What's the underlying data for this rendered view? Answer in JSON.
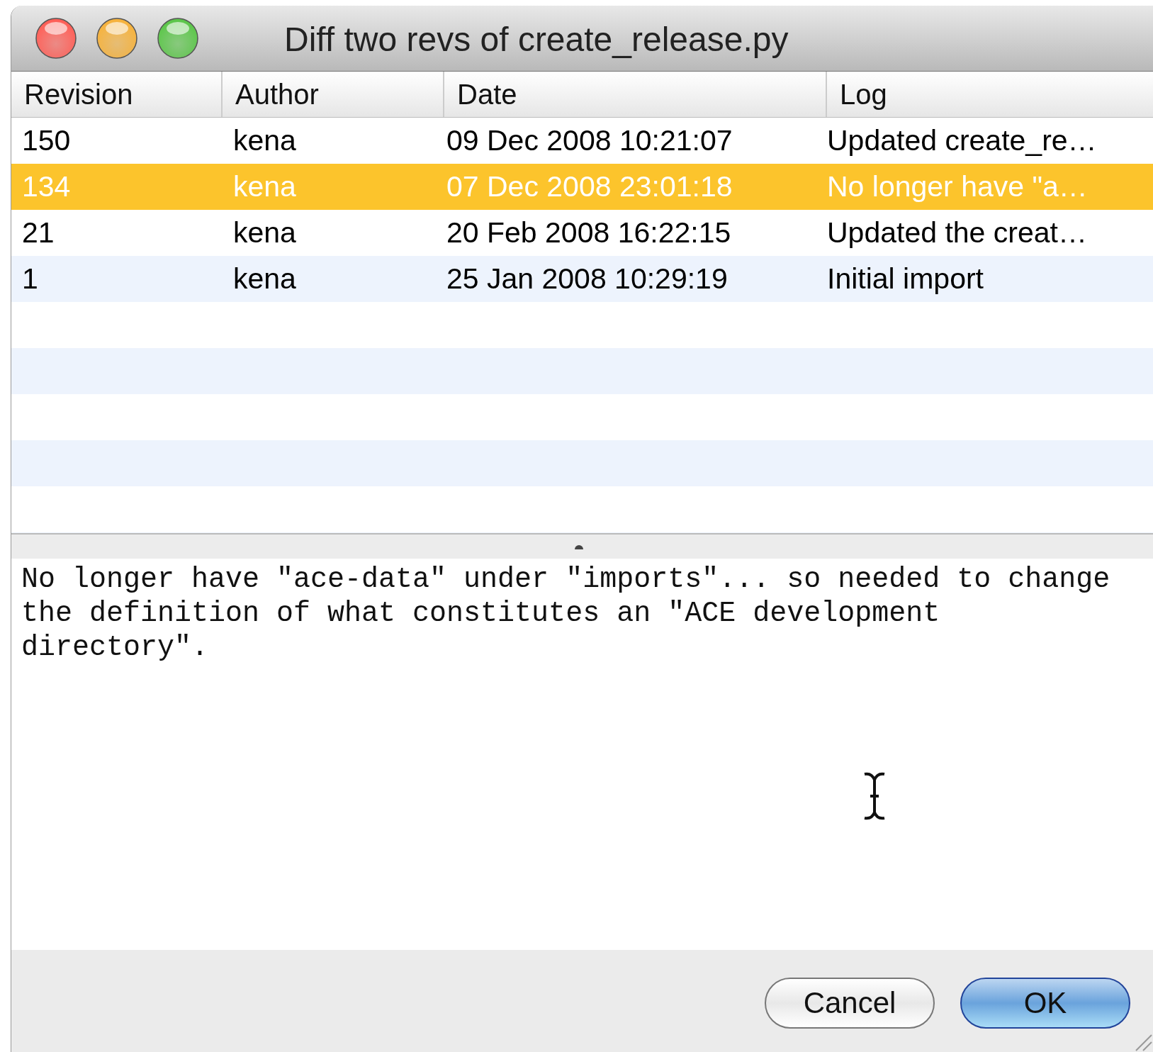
{
  "window": {
    "title": "Diff two revs of create_release.py"
  },
  "table": {
    "columns": [
      "Revision",
      "Author",
      "Date",
      "Log"
    ],
    "rows": [
      {
        "cells": [
          "150",
          "kena",
          "09 Dec 2008 10:21:07",
          "Updated create_re…"
        ],
        "selected": false
      },
      {
        "cells": [
          "134",
          "kena",
          "07 Dec 2008 23:01:18",
          "No longer have \"a…"
        ],
        "selected": true
      },
      {
        "cells": [
          "21",
          "kena",
          "20 Feb 2008 16:22:15",
          "Updated the creat…"
        ],
        "selected": false
      },
      {
        "cells": [
          "1",
          "kena",
          "25 Jan 2008 10:29:19",
          "Initial import"
        ],
        "selected": false
      }
    ]
  },
  "log_message": "No longer have \"ace-data\" under \"imports\"... so needed to change the definition of what constitutes an \"ACE development directory\".",
  "buttons": [
    {
      "label": "Cancel",
      "kind": "secondary"
    },
    {
      "label": "OK",
      "kind": "default"
    }
  ]
}
